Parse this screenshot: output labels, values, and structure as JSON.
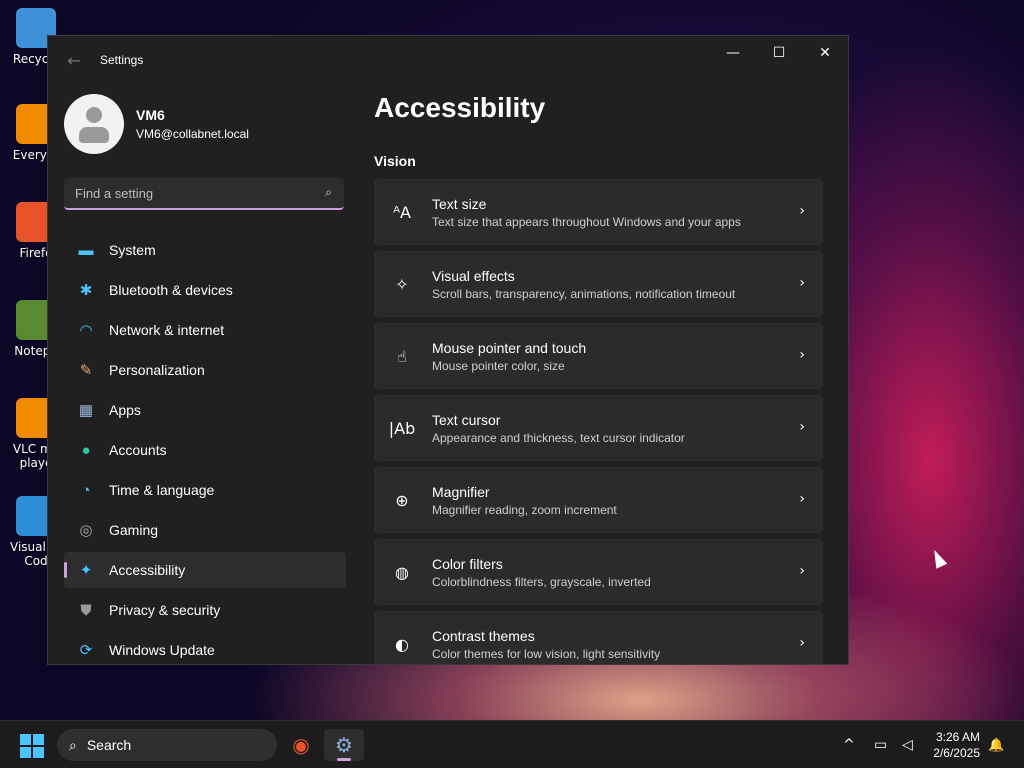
{
  "desktop": {
    "icons": [
      {
        "label": "Recycle",
        "glyph": "recycle-bin-icon",
        "color": "#3d8fd6"
      },
      {
        "label": "Everyth",
        "glyph": "everything-search-icon",
        "color": "#f08a00"
      },
      {
        "label": "Firefo",
        "glyph": "firefox-icon",
        "color": "#e8532a"
      },
      {
        "label": "Notepa",
        "glyph": "notepad-icon",
        "color": "#5a8a30"
      },
      {
        "label": "VLC me\nplaye",
        "glyph": "vlc-icon",
        "color": "#f08a00"
      },
      {
        "label": "Visual St\nCod",
        "glyph": "vscode-icon",
        "color": "#2f8ed8"
      }
    ]
  },
  "window": {
    "title": "Settings",
    "back_glyph": "←",
    "controls": {
      "minimize": "—",
      "maximize": "☐",
      "close": "✕"
    }
  },
  "profile": {
    "name": "VM6",
    "email": "VM6@collabnet.local"
  },
  "search": {
    "placeholder": "Find a setting",
    "icon_glyph": "⌕"
  },
  "nav": {
    "items": [
      {
        "label": "System",
        "icon": "system-monitor-icon",
        "glyph": "▬",
        "color": "#4cc2ff"
      },
      {
        "label": "Bluetooth & devices",
        "icon": "bluetooth-icon",
        "glyph": "✱",
        "color": "#4cc2ff"
      },
      {
        "label": "Network & internet",
        "icon": "wifi-icon",
        "glyph": "◠",
        "color": "#4cc2ff"
      },
      {
        "label": "Personalization",
        "icon": "brush-icon",
        "glyph": "✎",
        "color": "#e8a060"
      },
      {
        "label": "Apps",
        "icon": "apps-icon",
        "glyph": "▦",
        "color": "#a0b8d8"
      },
      {
        "label": "Accounts",
        "icon": "person-icon",
        "glyph": "●",
        "color": "#2ec4a0"
      },
      {
        "label": "Time & language",
        "icon": "globe-clock-icon",
        "glyph": "◔",
        "color": "#4cc2ff"
      },
      {
        "label": "Gaming",
        "icon": "gamepad-icon",
        "glyph": "◎",
        "color": "#b0b0b0"
      },
      {
        "label": "Accessibility",
        "icon": "accessibility-icon",
        "glyph": "✦",
        "color": "#4cc2ff",
        "active": true
      },
      {
        "label": "Privacy & security",
        "icon": "shield-icon",
        "glyph": "⛊",
        "color": "#9a9a9a"
      },
      {
        "label": "Windows Update",
        "icon": "update-icon",
        "glyph": "⟳",
        "color": "#4cc2ff"
      }
    ]
  },
  "main": {
    "title": "Accessibility",
    "section": "Vision",
    "cards": [
      {
        "title": "Text size",
        "desc": "Text size that appears throughout Windows and your apps",
        "icon": "text-size-icon",
        "glyph": "ᴬA"
      },
      {
        "title": "Visual effects",
        "desc": "Scroll bars, transparency, animations, notification timeout",
        "icon": "visual-effects-icon",
        "glyph": "✧"
      },
      {
        "title": "Mouse pointer and touch",
        "desc": "Mouse pointer color, size",
        "icon": "pointer-touch-icon",
        "glyph": "☝"
      },
      {
        "title": "Text cursor",
        "desc": "Appearance and thickness, text cursor indicator",
        "icon": "text-cursor-icon",
        "glyph": "|Ab"
      },
      {
        "title": "Magnifier",
        "desc": "Magnifier reading, zoom increment",
        "icon": "magnifier-icon",
        "glyph": "⊕"
      },
      {
        "title": "Color filters",
        "desc": "Colorblindness filters, grayscale, inverted",
        "icon": "palette-icon",
        "glyph": "◍"
      },
      {
        "title": "Contrast themes",
        "desc": "Color themes for low vision, light sensitivity",
        "icon": "contrast-icon",
        "glyph": "◐"
      }
    ],
    "chevron": "›"
  },
  "taskbar": {
    "search_label": "Search",
    "search_glyph": "⌕",
    "apps": [
      {
        "name": "firefox-taskbar-icon",
        "glyph": "◉",
        "color": "#e8532a"
      },
      {
        "name": "settings-taskbar-icon",
        "glyph": "⚙",
        "color": "#8ab0d8",
        "active": true
      }
    ],
    "tray": {
      "chevron": "^",
      "network": "▭",
      "volume": "◁"
    },
    "time": "3:26 AM",
    "date": "2/6/2025",
    "bell": "🔔"
  }
}
